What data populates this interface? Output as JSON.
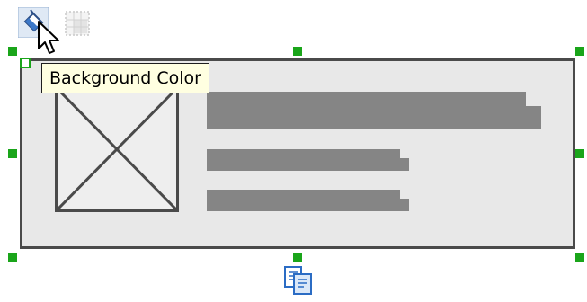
{
  "tooltip": {
    "text": "Background Color"
  },
  "colors": {
    "handle": "#1aa51a",
    "widget_fill": "#e8e8e8",
    "widget_border": "#4a4a4a",
    "text_placeholder": "#858585",
    "tooltip_bg": "#ffffe1",
    "paint_bucket": "#3c78c8"
  },
  "icons": {
    "toolbar": [
      "paint-bucket-icon",
      "grid-icon"
    ],
    "bottom": "copy-paste-icon",
    "cursor": "mouse-pointer-icon"
  }
}
